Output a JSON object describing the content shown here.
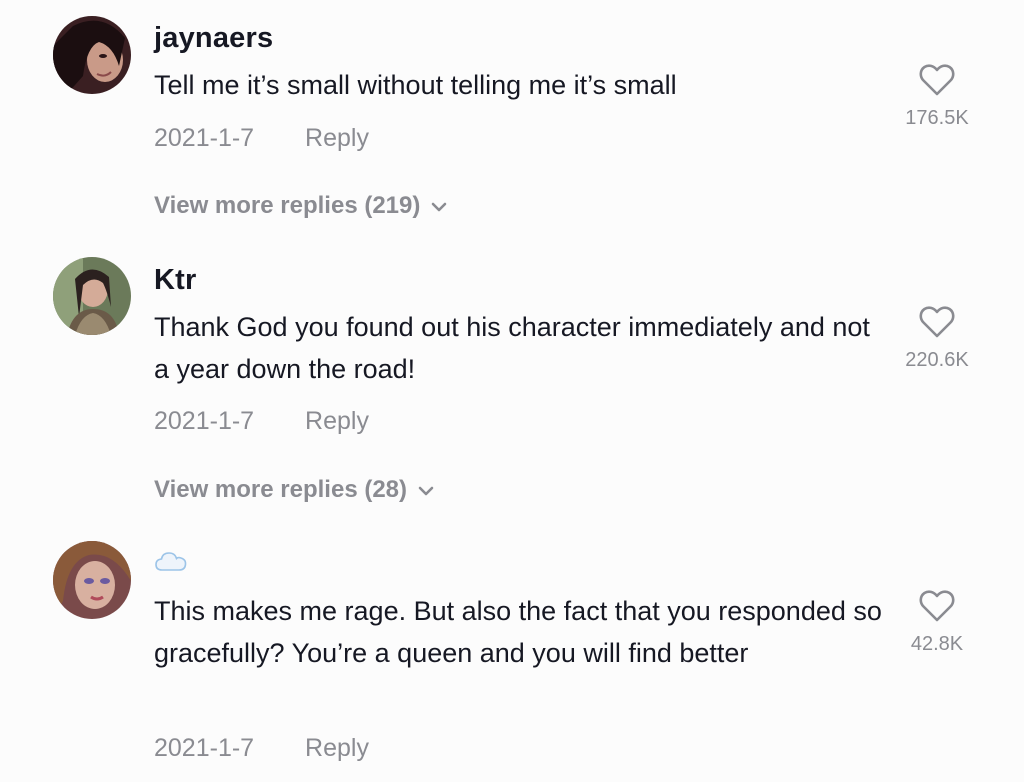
{
  "comments": [
    {
      "username": "jaynaers",
      "text": "Tell me it’s small without telling me it’s small",
      "date": "2021-1-7",
      "reply_label": "Reply",
      "likes": "176.5K",
      "more_replies": "View more replies (219)"
    },
    {
      "username": "Ktr",
      "text": "Thank God you found out his character immediately and not a year down the road!",
      "date": "2021-1-7",
      "reply_label": "Reply",
      "likes": "220.6K",
      "more_replies": "View more replies (28)"
    },
    {
      "username_icon": "cloud-icon",
      "text": "This makes me rage. But also the fact that you responded so gracefully? You’re a queen and you will find better",
      "date": "2021-1-7",
      "reply_label": "Reply",
      "likes": "42.8K"
    }
  ],
  "colors": {
    "primary_text": "#161823",
    "secondary_text": "#8a8b91",
    "background": "#fcfcfc"
  }
}
